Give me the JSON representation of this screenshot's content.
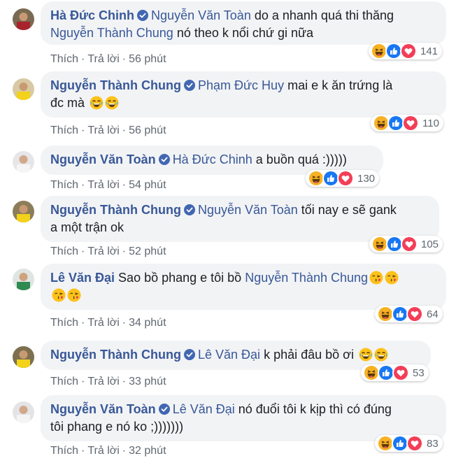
{
  "colors": {
    "link": "#385898",
    "haha": "#f7b125",
    "like": "#1877f2",
    "love": "#f33e58"
  },
  "actions": {
    "like": "Thích",
    "reply": "Trả lời",
    "dot": "·"
  },
  "comments": [
    {
      "author": "Hà Đức Chinh",
      "mention": "Nguyễn Văn Toàn",
      "text": "do a nhanh quá thi thăng",
      "mention2": "Nguyễn Thành Chung",
      "text2": "nó theo k nổi chứ gi nữa",
      "time": "56 phút",
      "count": "141"
    },
    {
      "author": "Nguyễn Thành Chung",
      "mention": "Phạm Đức Huy",
      "text": "mai e k ăn trứng là",
      "text2": "đc mà",
      "time": "56 phút",
      "count": "110"
    },
    {
      "author": "Nguyễn Văn Toàn",
      "mention": "Hà Đức Chinh",
      "text": "a buồn quá :)))))",
      "time": "54 phút",
      "count": "130"
    },
    {
      "author": "Nguyễn Thành Chung",
      "mention": "Nguyễn Văn Toàn",
      "text": "tối nay e sẽ gank",
      "text2": "a một trận ok",
      "time": "52 phút",
      "count": "105"
    },
    {
      "author": "Lê Văn Đại",
      "text": "Sao bồ phang e tôi bồ",
      "mention": "Nguyễn Thành Chung",
      "time": "34 phút",
      "count": "64"
    },
    {
      "author": "Nguyễn Thành Chung",
      "mention": "Lê Văn Đại",
      "text": "k phải đâu bồ ơi",
      "time": "33 phút",
      "count": "53"
    },
    {
      "author": "Nguyễn Văn Toàn",
      "mention": "Lê Văn Đại",
      "text": "nó đuổi tôi k kịp thì có đúng",
      "text2": "tôi phang e nó ko ;)))))))",
      "time": "32 phút",
      "count": "83"
    }
  ]
}
